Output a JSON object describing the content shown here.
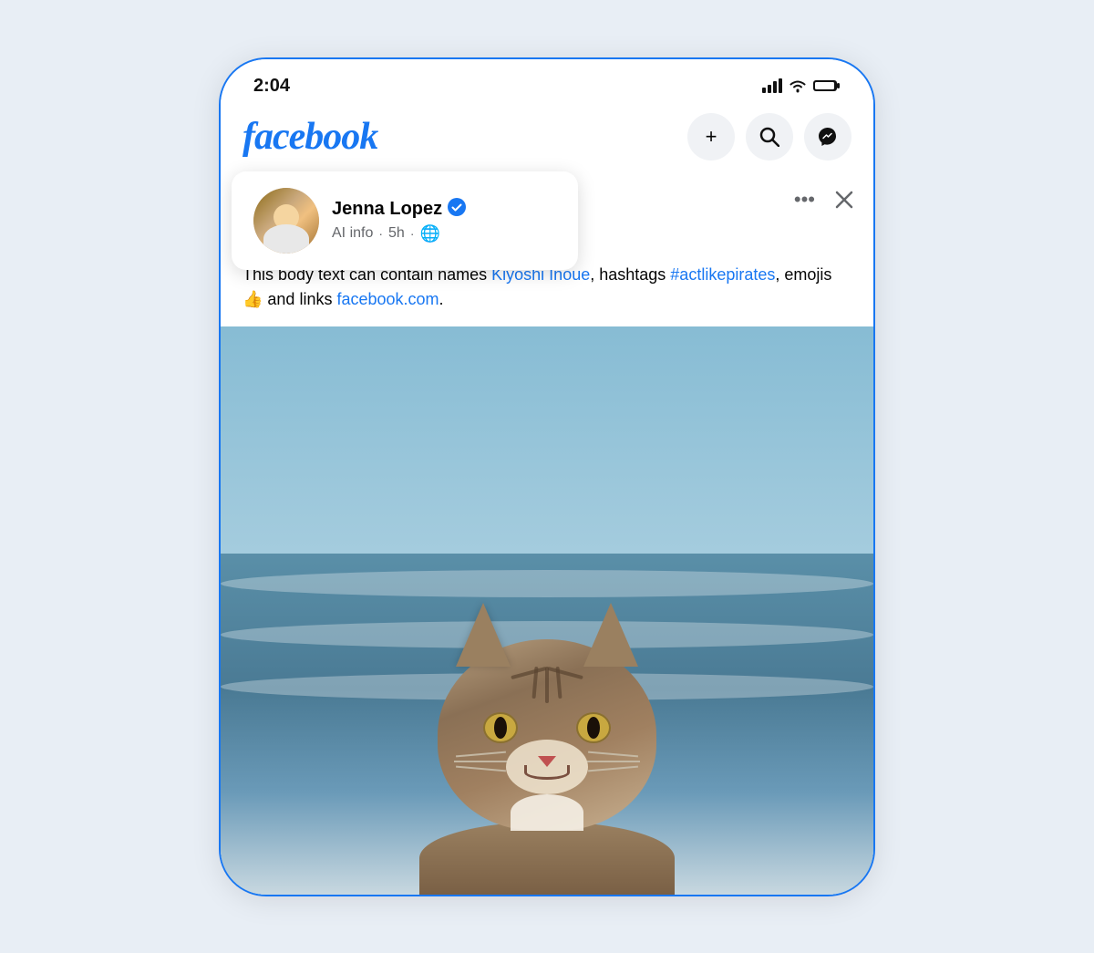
{
  "page": {
    "background_color": "#e8eef5"
  },
  "status_bar": {
    "time": "2:04",
    "signal_label": "signal",
    "wifi_label": "wifi",
    "battery_label": "battery"
  },
  "header": {
    "logo": "facebook",
    "add_button_label": "+",
    "search_button_label": "🔍",
    "messenger_button_label": "messenger"
  },
  "post": {
    "author": {
      "name": "Jenna Lopez",
      "verified": true,
      "verified_icon": "✓",
      "meta_label": "AI info",
      "time": "5h",
      "globe_icon": "🌐"
    },
    "body": {
      "text_prefix": "This body text can contain names ",
      "linked_name": "Kiyoshi Inoue",
      "text_middle": ", hashtags ",
      "hashtag": "#actlikepirates",
      "text_after": ", emojis 👍 and links ",
      "link": "facebook.com",
      "text_end": "."
    },
    "more_icon_label": "•••",
    "close_icon_label": "×",
    "image_alt": "Cat at the beach"
  }
}
